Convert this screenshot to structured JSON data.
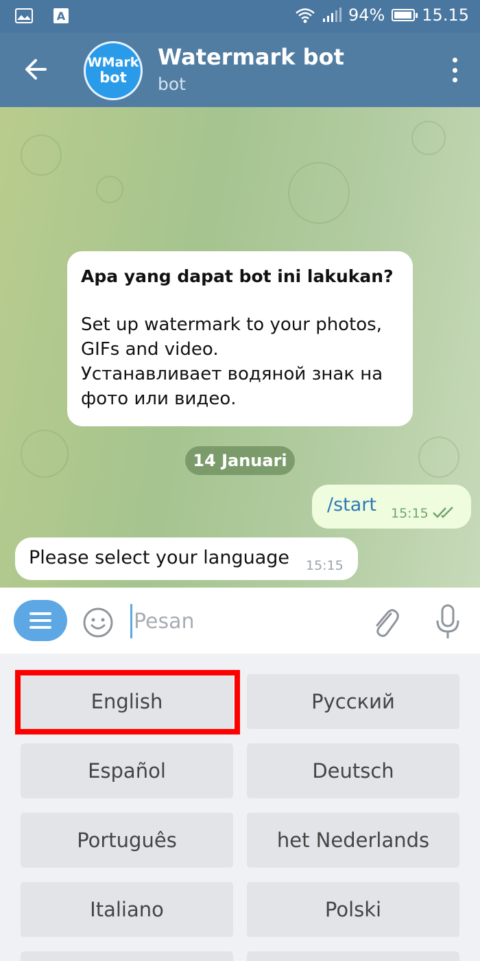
{
  "status_bar": {
    "battery_percent": "94%",
    "battery_level": 0.94,
    "time": "15.15",
    "icons": [
      "image-notification-icon",
      "keyboard-a-icon",
      "wifi-icon",
      "signal-icon",
      "battery-icon"
    ]
  },
  "header": {
    "title": "Watermark bot",
    "subtitle": "bot",
    "avatar_line1": "WMark",
    "avatar_line2": "bot"
  },
  "chat": {
    "info_title": "Apa yang dapat bot ini lakukan?",
    "info_lines": [
      "Set up watermark to your photos,",
      "GIFs and video.",
      "Устанавливает водяной знак на",
      "фото или видео."
    ],
    "date": "14 Januari",
    "out_message": {
      "text": "/start",
      "time": "15:15"
    },
    "in_message": {
      "text": "Please select your language",
      "time": "15:15"
    }
  },
  "input": {
    "placeholder": "Pesan"
  },
  "keyboard": {
    "buttons": [
      "English",
      "Русский",
      "Español",
      "Deutsch",
      "Português",
      "het Nederlands",
      "Italiano",
      "Polski"
    ]
  },
  "colors": {
    "header": "#517da2",
    "status_bar": "#4a77a0",
    "accent": "#5ca7e4",
    "outgoing_bubble": "#effdde",
    "highlight": "#ff0000"
  }
}
